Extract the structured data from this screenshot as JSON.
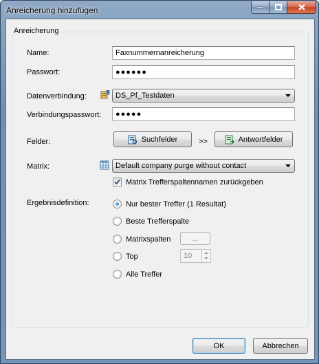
{
  "window": {
    "title": "Anreicherung hinzufügen"
  },
  "group": {
    "legend": "Anreicherung"
  },
  "fields": {
    "name_label": "Name:",
    "name_value": "Faxnummernanreicherung",
    "password_label": "Passwort:",
    "password_value": "●●●●●●",
    "connection_label": "Datenverbindung:",
    "connection_value": "DS_Pf_Testdaten",
    "conn_password_label": "Verbindungspasswort:",
    "conn_password_value": "●●●●●",
    "felder_label": "Felder:",
    "suchfelder_button": "Suchfelder",
    "arrow_text": ">>",
    "antwortfelder_button": "Antwortfelder",
    "matrix_label": "Matrix:",
    "matrix_value": "Default company purge without contact",
    "matrix_checkbox_label": "Matrix Trefferspaltennamen zurückgeben",
    "matrix_checkbox_checked": true
  },
  "ergebnis": {
    "label": "Ergebnisdefinition:",
    "options": [
      {
        "label": "Nur bester Treffer (1 Resultat)",
        "checked": true
      },
      {
        "label": "Beste Trefferspalte",
        "checked": false
      },
      {
        "label": "Matrixspalten",
        "checked": false
      },
      {
        "label": "Top",
        "checked": false
      },
      {
        "label": "Alle Treffer",
        "checked": false
      }
    ],
    "matrix_button": "...",
    "top_value": "10"
  },
  "buttons": {
    "ok": "OK",
    "cancel": "Abbrechen"
  },
  "colors": {
    "title_bar": "#7494bb",
    "dialog_bg": "#f0f0f0",
    "close_button": "#c3401f"
  }
}
